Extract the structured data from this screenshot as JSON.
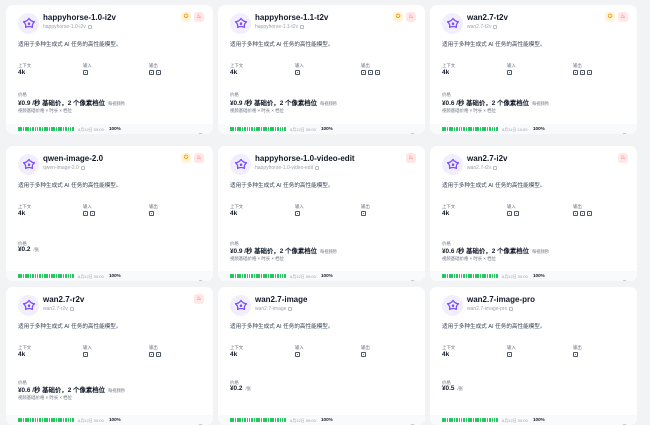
{
  "labels": {
    "context": "上下文",
    "input": "输入",
    "output": "输出",
    "price": "价格",
    "desc": "适用于多种生成式 AI 任务的高性能模型。"
  },
  "colors": {
    "brand": "#7c4dff",
    "progress": "#22c55e",
    "badge_gold": "#f59e0b",
    "badge_fire": "#ef4444"
  },
  "cards": [
    {
      "name": "happyhorse-1.0-i2v",
      "sub": "happyhorse-1.0-i2v",
      "badges": [
        "gold",
        "fire"
      ],
      "context": "4k",
      "inputs": 1,
      "outputs": 2,
      "price": "¥0.9 /秒 基础价，2 个像素档位",
      "price_note": "每视频秒",
      "price_desc": "视频基础价格 × 时长 × 档位",
      "time": "6月12日 09:00",
      "pct": "100%"
    },
    {
      "name": "happyhorse-1.1-t2v",
      "sub": "happyhorse-1.1-t2v",
      "badges": [
        "gold",
        "fire"
      ],
      "context": "4k",
      "inputs": 1,
      "outputs": 3,
      "price": "¥0.9 /秒 基础价，2 个像素档位",
      "price_note": "每视频秒",
      "price_desc": "视频基础价格 × 时长 × 档位",
      "time": "6月12日 09:00",
      "pct": "100%"
    },
    {
      "name": "wan2.7-t2v",
      "sub": "wan2.7-t2v",
      "badges": [
        "gold",
        "fire"
      ],
      "context": "4k",
      "inputs": 1,
      "outputs": 3,
      "price": "¥0.6 /秒 基础价，2 个像素档位",
      "price_note": "每视频秒",
      "price_desc": "视频基础价格 × 时长 × 档位",
      "time": "6月11日 10:00",
      "pct": "100%"
    },
    {
      "name": "qwen-image-2.0",
      "sub": "qwen-image-2.0",
      "badges": [
        "gold",
        "fire"
      ],
      "context": "4k",
      "inputs": 2,
      "outputs": 1,
      "price": "¥0.2",
      "price_note": "/张",
      "price_desc": "",
      "time": "6月12日 09:00",
      "pct": "100%"
    },
    {
      "name": "happyhorse-1.0-video-edit",
      "sub": "happyhorse-1.0-video-edit",
      "badges": [
        "fire"
      ],
      "context": "4k",
      "inputs": 1,
      "outputs": 1,
      "price": "¥0.9 /秒 基础价，2 个像素档位",
      "price_note": "每视频秒",
      "price_desc": "视频基础价格 × 时长 × 档位",
      "time": "6月12日 09:00",
      "pct": "100%"
    },
    {
      "name": "wan2.7-i2v",
      "sub": "wan2.7-i2v",
      "badges": [
        "fire"
      ],
      "context": "4k",
      "inputs": 2,
      "outputs": 3,
      "price": "¥0.6 /秒 基础价，2 个像素档位",
      "price_note": "每视频秒",
      "price_desc": "视频基础价格 × 时长 × 档位",
      "time": "6月12日 09:00",
      "pct": "100%"
    },
    {
      "name": "wan2.7-r2v",
      "sub": "wan2.7-r2v",
      "badges": [
        "fire"
      ],
      "context": "4k",
      "inputs": 1,
      "outputs": 2,
      "price": "¥0.6 /秒 基础价，2 个像素档位",
      "price_note": "每视频秒",
      "price_desc": "视频基础价格 × 时长 × 档位",
      "time": "6月12日 09:00",
      "pct": "100%"
    },
    {
      "name": "wan2.7-image",
      "sub": "wan2.7-image",
      "badges": [],
      "context": "4k",
      "inputs": 1,
      "outputs": 1,
      "price": "¥0.2",
      "price_note": "/张",
      "price_desc": "",
      "time": "6月12日 09:00",
      "pct": "100%"
    },
    {
      "name": "wan2.7-image-pro",
      "sub": "wan2.7-image-pro",
      "badges": [],
      "context": "4k",
      "inputs": 1,
      "outputs": 1,
      "price": "¥0.5",
      "price_note": "/张",
      "price_desc": "",
      "time": "6月12日 09:00",
      "pct": "100%"
    }
  ]
}
